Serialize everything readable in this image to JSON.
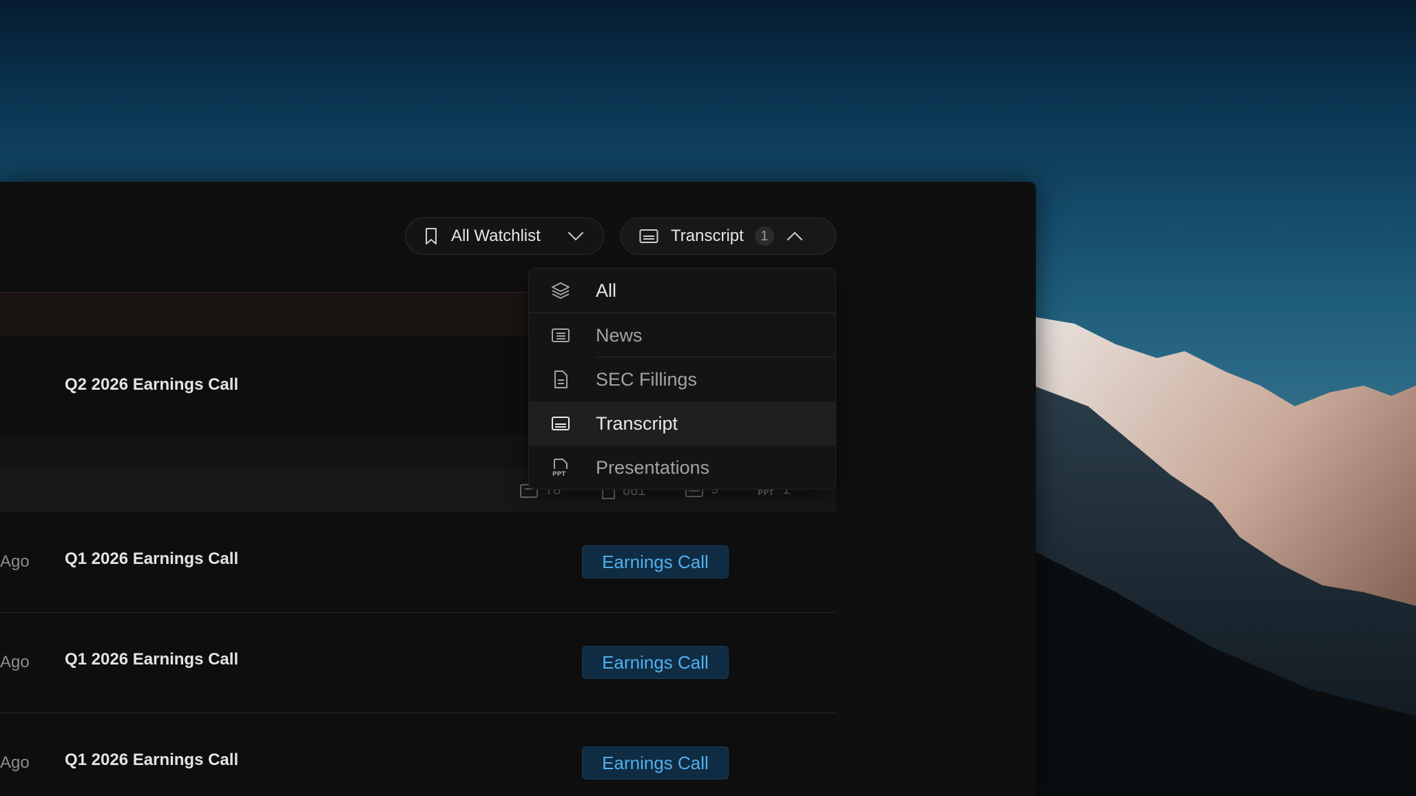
{
  "toolbar": {
    "watchlist_label": "All Watchlist",
    "type_filter_label": "Transcript",
    "type_filter_count": "1"
  },
  "dropdown": {
    "items": [
      {
        "label": "All",
        "icon": "layers-icon"
      },
      {
        "label": "News",
        "icon": "news-icon"
      },
      {
        "label": "SEC Fillings",
        "icon": "document-icon"
      },
      {
        "label": "Transcript",
        "icon": "transcript-icon",
        "selected": true
      },
      {
        "label": "Presentations",
        "icon": "ppt-icon"
      }
    ]
  },
  "stats": {
    "news": "78",
    "filings": "661",
    "transcripts": "9",
    "presentations": "1"
  },
  "rows": [
    {
      "ago": "",
      "title": "Q2 2026 Earnings Call",
      "badge": ""
    },
    {
      "ago": "Ago",
      "title": "Q1 2026 Earnings Call",
      "badge": "Earnings Call"
    },
    {
      "ago": "Ago",
      "title": "Q1 2026 Earnings Call",
      "badge": "Earnings Call"
    },
    {
      "ago": "Ago",
      "title": "Q1 2026 Earnings Call",
      "badge": "Earnings Call"
    }
  ],
  "colors": {
    "badge_text": "#4fb0ef",
    "badge_bg": "#102c42",
    "window_bg": "#0f0f10"
  }
}
